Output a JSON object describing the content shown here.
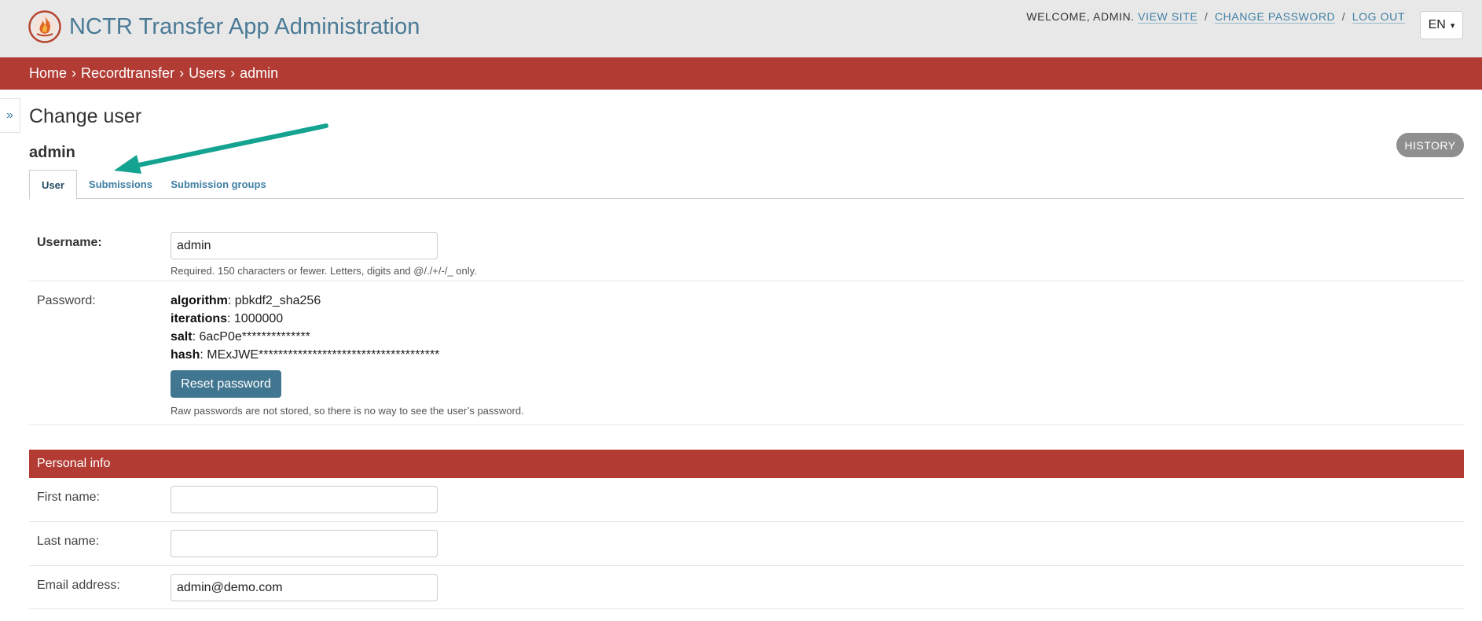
{
  "header": {
    "title": "NCTR Transfer App Administration",
    "welcome": "WELCOME,",
    "username": "ADMIN.",
    "links": [
      "VIEW SITE",
      "CHANGE PASSWORD",
      "LOG OUT"
    ],
    "separator": "/",
    "language": "EN",
    "logo_icon": "flame-logo-icon"
  },
  "breadcrumbs": {
    "items": [
      "Home",
      "Recordtransfer",
      "Users",
      "admin"
    ],
    "separator": "›"
  },
  "nav_toggle": "»",
  "page": {
    "title": "Change user",
    "object_name": "admin",
    "history_label": "HISTORY"
  },
  "tabs": [
    {
      "label": "User",
      "active": true
    },
    {
      "label": "Submissions",
      "active": false
    },
    {
      "label": "Submission groups",
      "active": false
    }
  ],
  "form": {
    "username": {
      "label": "Username:",
      "value": "admin",
      "help": "Required. 150 characters or fewer. Letters, digits and @/./+/-/_ only."
    },
    "password": {
      "label": "Password:",
      "details": [
        {
          "key": "algorithm",
          "value": ": pbkdf2_sha256"
        },
        {
          "key": "iterations",
          "value": ": 1000000"
        },
        {
          "key": "salt",
          "value": ": 6acP0e**************"
        },
        {
          "key": "hash",
          "value": ": MExJWE*************************************"
        }
      ],
      "reset_label": "Reset password",
      "help": "Raw passwords are not stored, so there is no way to see the user’s password."
    },
    "personal_info": {
      "caption": "Personal info",
      "first_name": {
        "label": "First name:",
        "value": ""
      },
      "last_name": {
        "label": "Last name:",
        "value": ""
      },
      "email": {
        "label": "Email address:",
        "value": "admin@demo.com"
      }
    }
  },
  "colors": {
    "header_bg": "#e8e8e8",
    "accent_red": "#b23c34",
    "link_blue": "#3f7fa3",
    "button_blue": "#417690",
    "arrow_teal": "#14a391"
  }
}
